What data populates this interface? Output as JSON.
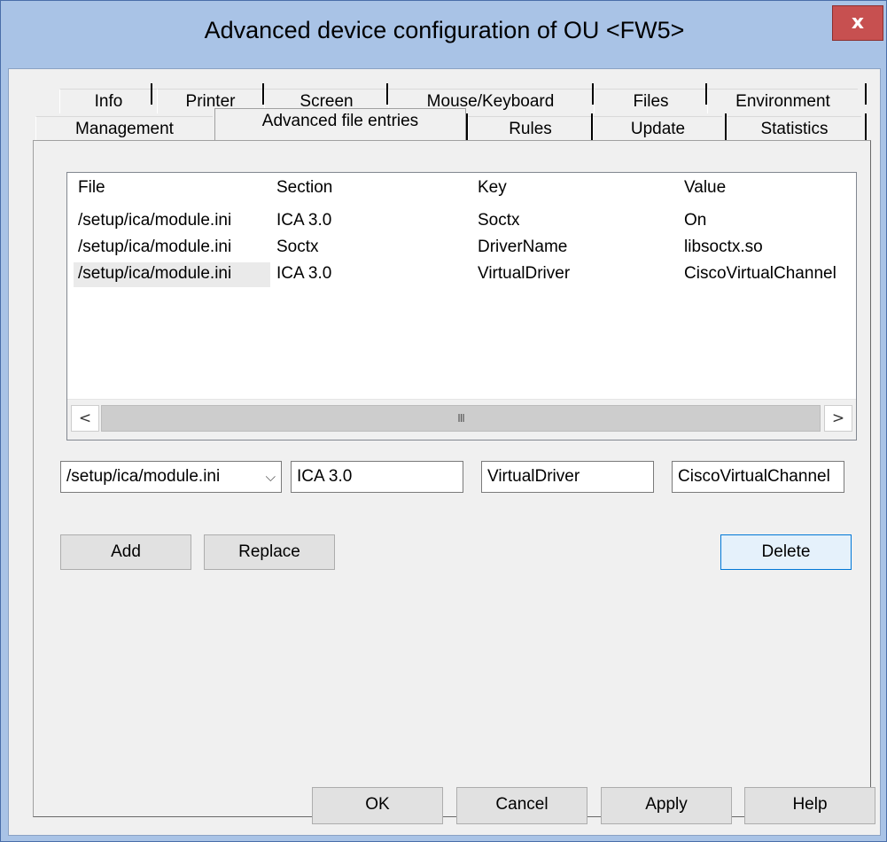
{
  "window": {
    "title": "Advanced device configuration of OU <FW5>",
    "close_label": "x"
  },
  "tabs_row1": [
    "Info",
    "Printer",
    "Screen",
    "Mouse/Keyboard",
    "Files",
    "Environment"
  ],
  "tabs_row2": [
    "Management",
    "Advanced file entries",
    "Rules",
    "Update",
    "Statistics"
  ],
  "active_tab": "Advanced file entries",
  "table": {
    "columns": [
      "File",
      "Section",
      "Key",
      "Value"
    ],
    "rows": [
      [
        "/setup/ica/module.ini",
        "ICA 3.0",
        "Soctx",
        "On"
      ],
      [
        "/setup/ica/module.ini",
        "Soctx",
        "DriverName",
        "libsoctx.so"
      ],
      [
        "/setup/ica/module.ini",
        "ICA 3.0",
        "VirtualDriver",
        "CiscoVirtualChannel"
      ]
    ],
    "scroll_left": "<",
    "scroll_right": ">",
    "scroll_thumb_grip": "III"
  },
  "editor": {
    "file_value": "/setup/ica/module.ini",
    "section_value": "ICA 3.0",
    "key_value": "VirtualDriver",
    "value_value": "CiscoVirtualChannel"
  },
  "actions": {
    "add": "Add",
    "replace": "Replace",
    "delete": "Delete"
  },
  "footer": {
    "ok": "OK",
    "cancel": "Cancel",
    "apply": "Apply",
    "help": "Help"
  },
  "icons": {
    "combo": "chevron-down-icon",
    "close": "close-icon"
  },
  "colors": {
    "title_bar": "#a9c3e6",
    "close_button": "#c75050",
    "default_button_border": "#0078d7"
  }
}
